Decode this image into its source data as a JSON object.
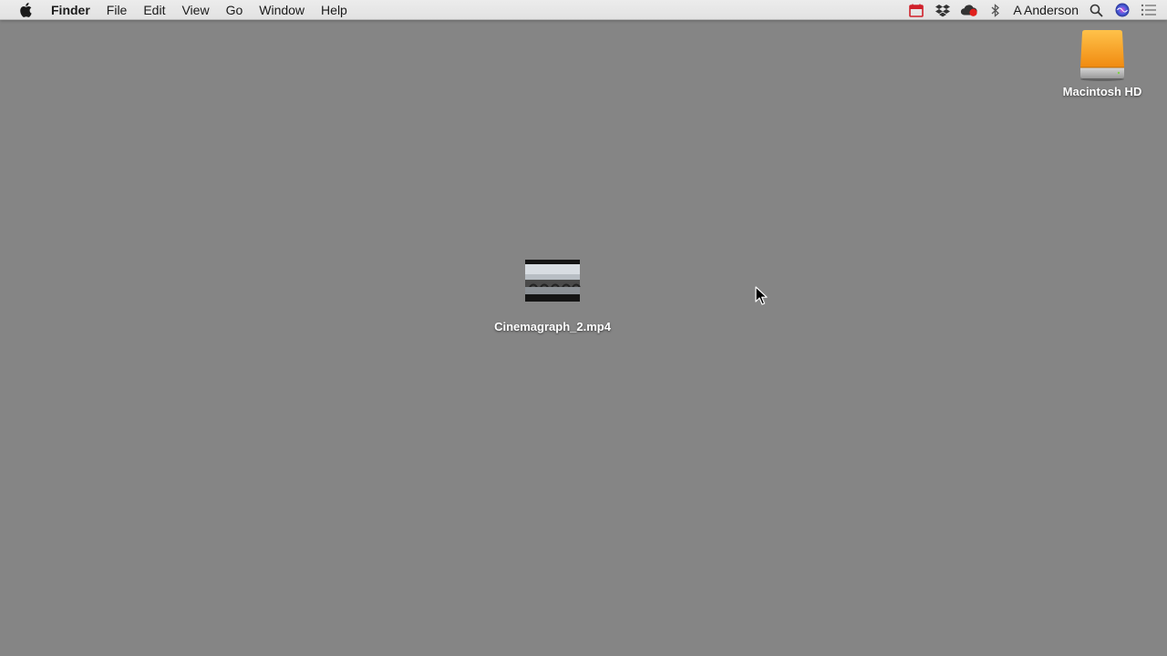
{
  "menubar": {
    "apple_icon": "apple-icon",
    "app_name": "Finder",
    "menus": [
      "File",
      "Edit",
      "View",
      "Go",
      "Window",
      "Help"
    ],
    "status_icons": [
      "calendar-icon",
      "dropbox-icon",
      "creative-cloud-icon",
      "bluetooth-icon"
    ],
    "user_name": "A Anderson",
    "right_icons": [
      "spotlight-search-icon",
      "siri-icon",
      "notification-center-icon"
    ]
  },
  "desktop": {
    "background_color": "#858585",
    "icons": [
      {
        "label": "Macintosh HD",
        "icon": "hard-drive-icon"
      },
      {
        "label": "Cinemagraph_2.mp4",
        "icon": "video-file-thumbnail"
      }
    ]
  }
}
